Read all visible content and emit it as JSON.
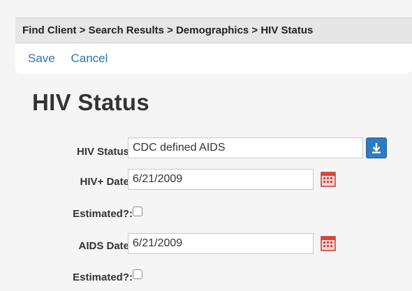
{
  "breadcrumb": {
    "text": "Find Client > Search Results > Demographics > HIV Status"
  },
  "actions": {
    "save_label": "Save",
    "cancel_label": "Cancel"
  },
  "page": {
    "title": "HIV Status"
  },
  "form": {
    "hiv_status": {
      "label": "HIV Status:",
      "value": "CDC defined AIDS"
    },
    "hiv_date": {
      "label": "HIV+ Date:",
      "value": "6/21/2009"
    },
    "hiv_estimated": {
      "label": "Estimated?:",
      "checked": false
    },
    "aids_date": {
      "label": "AIDS Date:",
      "value": "6/21/2009"
    },
    "aids_estimated": {
      "label": "Estimated?:",
      "checked": false
    }
  },
  "icons": {
    "dropdown": "download-arrow-icon",
    "calendar": "calendar-icon"
  },
  "colors": {
    "link": "#2b73b7",
    "dropdown_button": "#2e7bbf",
    "calendar_red": "#d9433c"
  }
}
